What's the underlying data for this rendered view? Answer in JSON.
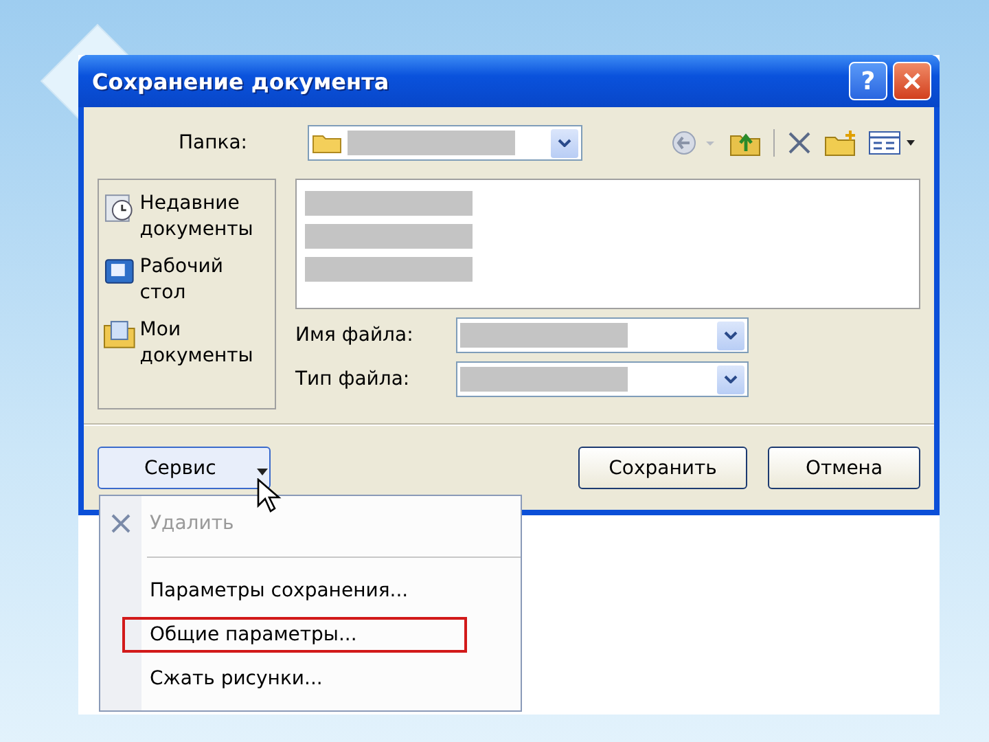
{
  "window": {
    "title": "Сохранение документа",
    "help": "?"
  },
  "folder": {
    "label": "Папка:"
  },
  "places": [
    {
      "label": "Недавние документы"
    },
    {
      "label": "Рабочий стол"
    },
    {
      "label": "Мои документы"
    }
  ],
  "fields": [
    {
      "label": "Имя файла:"
    },
    {
      "label": "Тип файла:"
    }
  ],
  "tools_button": "Сервис",
  "save_button": "Сохранить",
  "cancel_button": "Отмена",
  "menu": [
    {
      "kind": "item",
      "label": "Удалить",
      "disabled": true,
      "highlighted": false
    },
    {
      "kind": "separator"
    },
    {
      "kind": "item",
      "label": "Параметры сохранения...",
      "disabled": false,
      "highlighted": false
    },
    {
      "kind": "item",
      "label": "Общие параметры...",
      "disabled": false,
      "highlighted": true
    },
    {
      "kind": "item",
      "label": "Сжать рисунки...",
      "disabled": false,
      "highlighted": false
    }
  ]
}
